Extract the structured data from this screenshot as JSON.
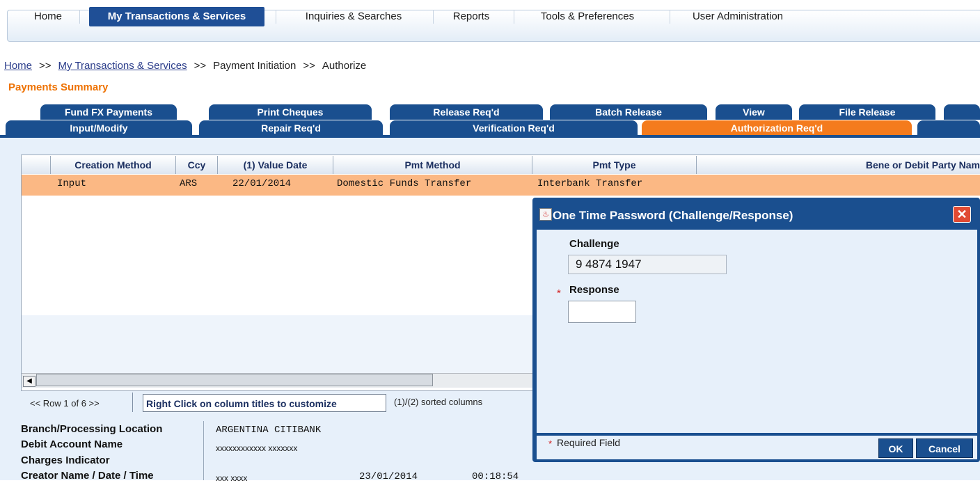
{
  "nav": {
    "items": [
      {
        "label": "Home",
        "active": false
      },
      {
        "label": "My Transactions & Services",
        "active": true
      },
      {
        "label": "Inquiries & Searches",
        "active": false
      },
      {
        "label": "Reports",
        "active": false
      },
      {
        "label": "Tools & Preferences",
        "active": false
      },
      {
        "label": "User Administration",
        "active": false
      }
    ]
  },
  "breadcrumb": {
    "items": [
      "Home",
      "My Transactions & Services",
      "Payment Initiation",
      "Authorize"
    ],
    "separator": ">>"
  },
  "page_title": "Payments Summary",
  "tabs": {
    "row1": [
      "Fund FX Payments",
      "Print Cheques",
      "Release Req'd",
      "Batch Release",
      "View",
      "File Release"
    ],
    "row2": [
      "Input/Modify",
      "Repair Req'd",
      "Verification Req'd",
      "Authorization Req'd"
    ],
    "active": "Authorization Req'd"
  },
  "table": {
    "columns": [
      "Creation Method",
      "Ccy",
      "(1) Value Date",
      "Pmt Method",
      "Pmt Type",
      "Bene or Debit Party Nam"
    ],
    "rows": [
      [
        "Input",
        "ARS",
        "22/01/2014",
        "Domestic Funds Transfer",
        "Interbank Transfer",
        ""
      ]
    ]
  },
  "table_footer": {
    "row_info": "<< Row 1 of 6 >>",
    "customize_label": "Right Click on column titles to customize",
    "sorted_label": "(1)/(2) sorted columns"
  },
  "details": {
    "labels": [
      "Branch/Processing Location",
      "Debit Account Name",
      "Charges Indicator",
      "Creator Name / Date / Time"
    ],
    "branch_value": "ARGENTINA CITIBANK",
    "debit_account_value": "xxxxxxxxxxxx xxxxxxx",
    "creator_name": "xxx xxxx",
    "creator_date": "23/01/2014",
    "creator_time": "00:18:54"
  },
  "dialog": {
    "title": "One Time Password (Challenge/Response)",
    "challenge_label": "Challenge",
    "challenge_value": "9 4874 1947",
    "response_label": "Response",
    "response_value": "",
    "required_star": "*",
    "required_note": "Required Field",
    "ok_label": "OK",
    "cancel_label": "Cancel",
    "close_glyph": "✕",
    "icon_glyph": "♨"
  },
  "colors": {
    "brand_blue": "#1a4f8f",
    "accent_orange": "#f47b1d",
    "selected_row": "#fbb884"
  }
}
